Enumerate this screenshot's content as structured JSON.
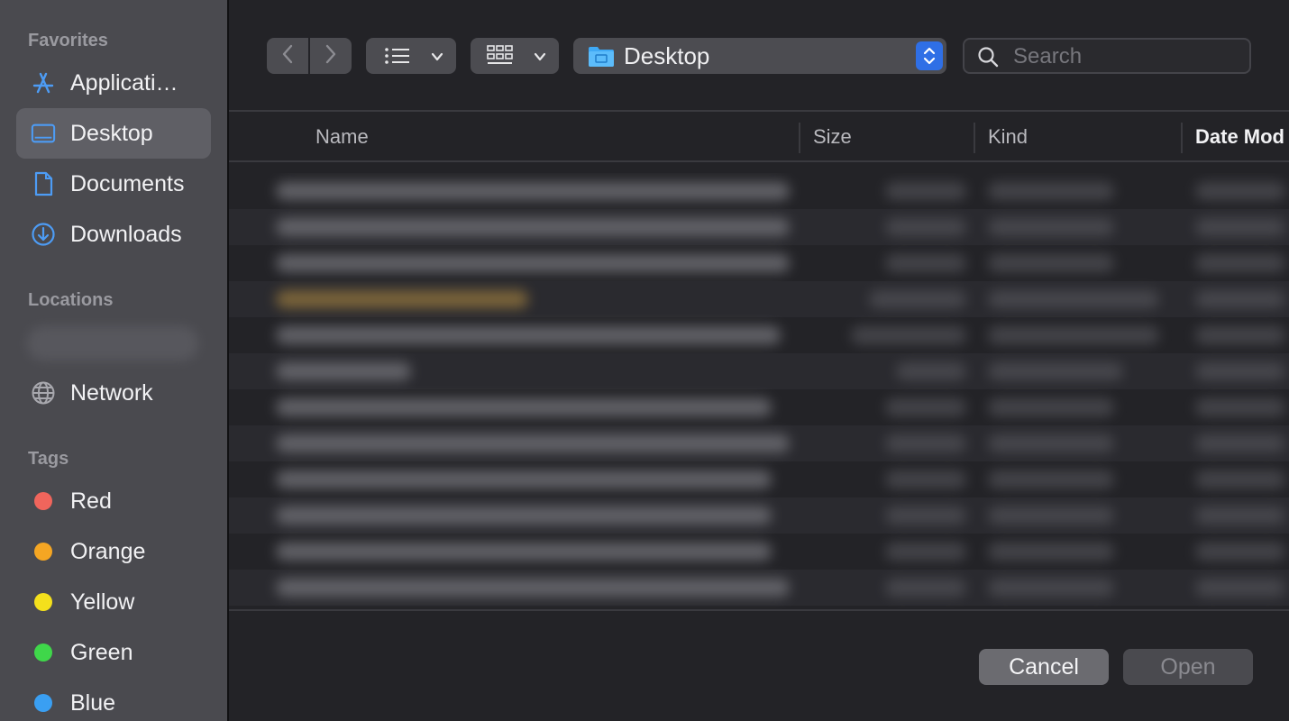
{
  "sidebar": {
    "favorites_title": "Favorites",
    "favorites": [
      {
        "label": "Applicati…",
        "icon": "applications-icon"
      },
      {
        "label": "Desktop",
        "icon": "desktop-icon"
      },
      {
        "label": "Documents",
        "icon": "document-icon"
      },
      {
        "label": "Downloads",
        "icon": "downloads-icon"
      }
    ],
    "locations_title": "Locations",
    "network_label": "Network",
    "tags_title": "Tags",
    "tags": [
      {
        "label": "Red",
        "color": "#f0655c"
      },
      {
        "label": "Orange",
        "color": "#f5a623"
      },
      {
        "label": "Yellow",
        "color": "#f4e01c"
      },
      {
        "label": "Green",
        "color": "#3fd74a"
      },
      {
        "label": "Blue",
        "color": "#3a9ff2"
      }
    ]
  },
  "toolbar": {
    "location": "Desktop",
    "search_placeholder": "Search"
  },
  "table": {
    "columns": [
      "Name",
      "Size",
      "Kind",
      "Date Mod"
    ]
  },
  "footer": {
    "cancel_label": "Cancel",
    "open_label": "Open"
  },
  "colors": {
    "accent": "#2f6fe6",
    "folder": "#3fa9f5"
  }
}
